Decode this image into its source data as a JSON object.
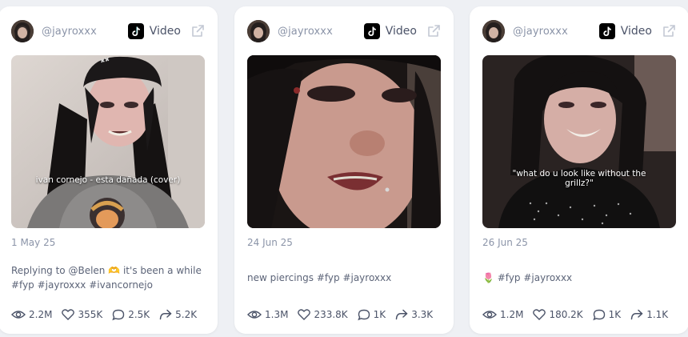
{
  "cards": [
    {
      "handle": "@jayroxxx",
      "type_label": "Video",
      "overlay_text": "ivan cornejo - esta dañada (cover)",
      "date": "1 May 25",
      "caption": "Replying to @Belen 🫶 it's been a while #fyp #jayroxxx #ivancornejo",
      "views": "2.2M",
      "likes": "355K",
      "comments": "2.5K",
      "shares": "5.2K"
    },
    {
      "handle": "@jayroxxx",
      "type_label": "Video",
      "overlay_text": "",
      "date": "24 Jun 25",
      "caption": "new piercings #fyp #jayroxxx",
      "views": "1.3M",
      "likes": "233.8K",
      "comments": "1K",
      "shares": "3.3K"
    },
    {
      "handle": "@jayroxxx",
      "type_label": "Video",
      "overlay_text": "\"what do u look like without the grillz?\"",
      "date": "26 Jun 25",
      "caption": "🌷 #fyp #jayroxxx",
      "views": "1.2M",
      "likes": "180.2K",
      "comments": "1K",
      "shares": "1.1K"
    }
  ],
  "icons": {
    "platform": "tiktok-icon",
    "external": "external-link-icon",
    "views": "eye-icon",
    "likes": "heart-icon",
    "comments": "comment-icon",
    "shares": "share-icon"
  },
  "colors": {
    "muted": "#8b94a8",
    "text": "#4b5368",
    "card": "#ffffff",
    "background": "#eef0f4"
  }
}
